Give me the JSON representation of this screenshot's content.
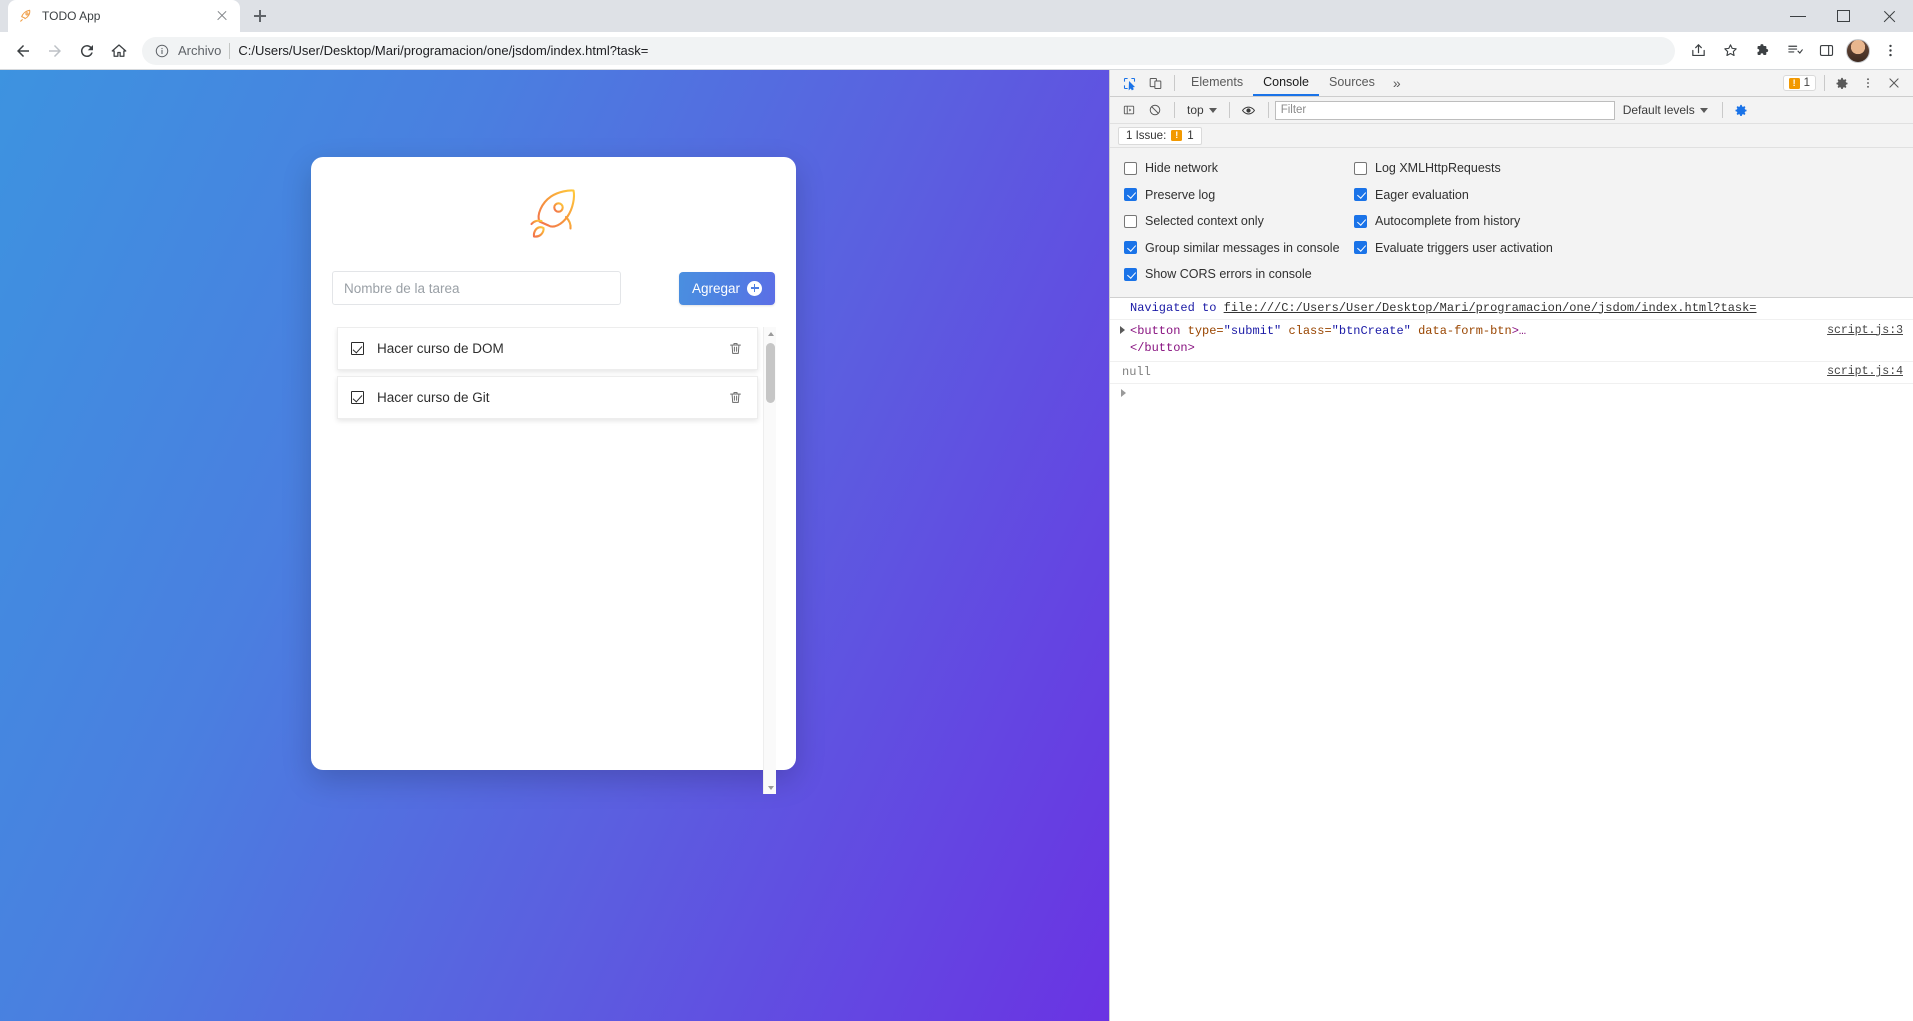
{
  "browser": {
    "tab": {
      "title": "TODO App",
      "favicon": "rocket-icon",
      "close": "close-icon"
    },
    "new_tab_label": "+",
    "window_controls": {
      "minimize": "minimize-icon",
      "maximize": "maximize-icon",
      "close": "close-icon"
    },
    "nav": {
      "back": "back-arrow-icon",
      "forward": "forward-arrow-icon",
      "reload": "reload-icon",
      "home": "home-icon"
    },
    "omnibox": {
      "info_icon": "info-circle-icon",
      "scheme_label": "Archivo",
      "url": "C:/Users/User/Desktop/Mari/programacion/one/jsdom/index.html?task=",
      "share_icon": "share-icon",
      "bookmark_icon": "star-icon"
    },
    "toolbar_right": {
      "extensions": "puzzle-icon",
      "reading_list": "reading-list-icon",
      "side_panel": "side-panel-icon",
      "profile": "avatar",
      "menu": "three-dots-icon"
    }
  },
  "page": {
    "background_gradient": [
      "#3d93e0",
      "#6a33e3"
    ],
    "logo": "rocket-icon",
    "logo_colors": [
      "#f2714e",
      "#ffc93c"
    ],
    "input": {
      "placeholder": "Nombre de la tarea",
      "value": ""
    },
    "add_button": {
      "label": "Agregar",
      "icon": "plus-circle-icon",
      "color": "#4f7fe2"
    },
    "tasks": [
      {
        "label": "Hacer curso de DOM",
        "checked": true,
        "delete_icon": "trash-icon"
      },
      {
        "label": "Hacer curso de Git",
        "checked": true,
        "delete_icon": "trash-icon"
      }
    ],
    "scrollbar": {
      "up": "scroll-up-arrow-icon",
      "down": "scroll-down-arrow-icon"
    }
  },
  "devtools": {
    "toolbar": {
      "inspect_icon": "inspect-element-icon",
      "device_icon": "device-toolbar-icon",
      "tabs": [
        {
          "label": "Elements",
          "active": false
        },
        {
          "label": "Console",
          "active": true
        },
        {
          "label": "Sources",
          "active": false
        }
      ],
      "more_tabs": "»",
      "issues_badge": {
        "icon": "issue-warning-icon",
        "count": "1"
      },
      "settings_icon": "gear-icon",
      "kebab_icon": "three-dots-icon",
      "close_icon": "close-icon"
    },
    "filterbar": {
      "sidebar_icon": "console-sidebar-icon",
      "clear_icon": "clear-console-icon",
      "context": "top",
      "eye_icon": "live-expression-icon",
      "filter_placeholder": "Filter",
      "filter_value": "",
      "levels": "Default levels",
      "settings_icon": "gear-icon"
    },
    "issues_bar": {
      "label": "1 Issue:",
      "count": "1",
      "icon": "issue-warning-icon"
    },
    "settings": [
      {
        "label": "Hide network",
        "checked": false
      },
      {
        "label": "Log XMLHttpRequests",
        "checked": false
      },
      {
        "label": "Preserve log",
        "checked": true
      },
      {
        "label": "Eager evaluation",
        "checked": true
      },
      {
        "label": "Selected context only",
        "checked": false
      },
      {
        "label": "Autocomplete from history",
        "checked": true
      },
      {
        "label": "Group similar messages in console",
        "checked": true
      },
      {
        "label": "Evaluate triggers user activation",
        "checked": true
      },
      {
        "label": "Show CORS errors in console",
        "checked": true
      }
    ],
    "messages": [
      {
        "type": "navigation",
        "prefix": "Navigated to ",
        "link": "file:///C:/Users/User/Desktop/Mari/programacion/one/jsdom/index.html?task=",
        "source": ""
      },
      {
        "type": "object",
        "source": "script.js:3",
        "tag_open": "<button",
        "attr1_name": " type=",
        "attr1_value": "\"submit\"",
        "attr2_name": " class=",
        "attr2_value": "\"btnCreate\"",
        "attr3_name": " data-form-btn",
        "tag_close_bracket": ">…",
        "tag_close": "</button>"
      },
      {
        "type": "value",
        "value": "null",
        "source": "script.js:4"
      }
    ],
    "prompt": {
      "caret": ">",
      "value": ""
    }
  }
}
